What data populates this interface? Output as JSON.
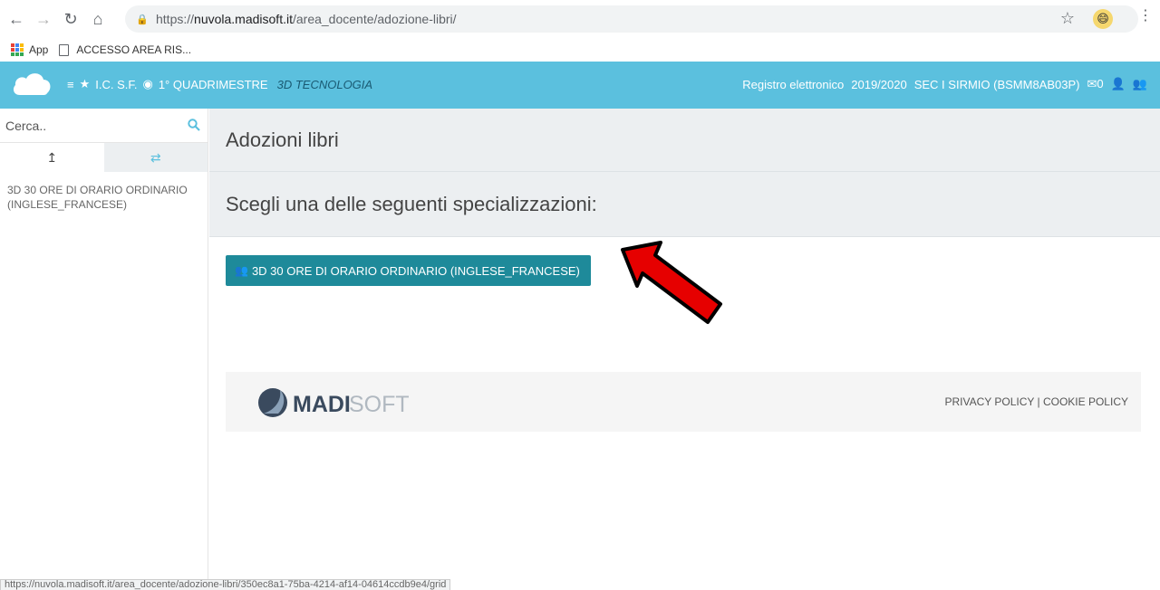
{
  "browser": {
    "url_scheme": "https://",
    "url_host": "nuvola.madisoft.it",
    "url_path": "/area_docente/adozione-libri/",
    "bookmarks": [
      "App",
      "ACCESSO AREA RIS..."
    ],
    "status_url": "https://nuvola.madisoft.it/area_docente/adozione-libri/350ec8a1-75ba-4214-af14-04614ccdb9e4/grid"
  },
  "appbar": {
    "school": "I.C. S.F.",
    "period": "1° QUADRIMESTRE",
    "class_subject": "3D  TECNOLOGIA",
    "register": "Registro elettronico",
    "year": "2019/2020",
    "school_code": "SEC I SIRMIO (BSMM8AB03P)",
    "messages_count": "0"
  },
  "sidebar": {
    "search_placeholder": "Cerca..",
    "item": "3D 30 ORE DI ORARIO ORDINARIO (INGLESE_FRANCESE)"
  },
  "main": {
    "title": "Adozioni libri",
    "subtitle": "Scegli una delle seguenti specializzazioni:",
    "spec_button": "3D 30 ORE DI ORARIO ORDINARIO (INGLESE_FRANCESE)"
  },
  "footer": {
    "logo_bold": "MADI",
    "logo_light": "SOFT",
    "links": "PRIVACY POLICY | COOKIE POLICY"
  },
  "colors": {
    "appbar": "#5bc0de",
    "button": "#1e8a9a",
    "arrow": "#e60000"
  }
}
